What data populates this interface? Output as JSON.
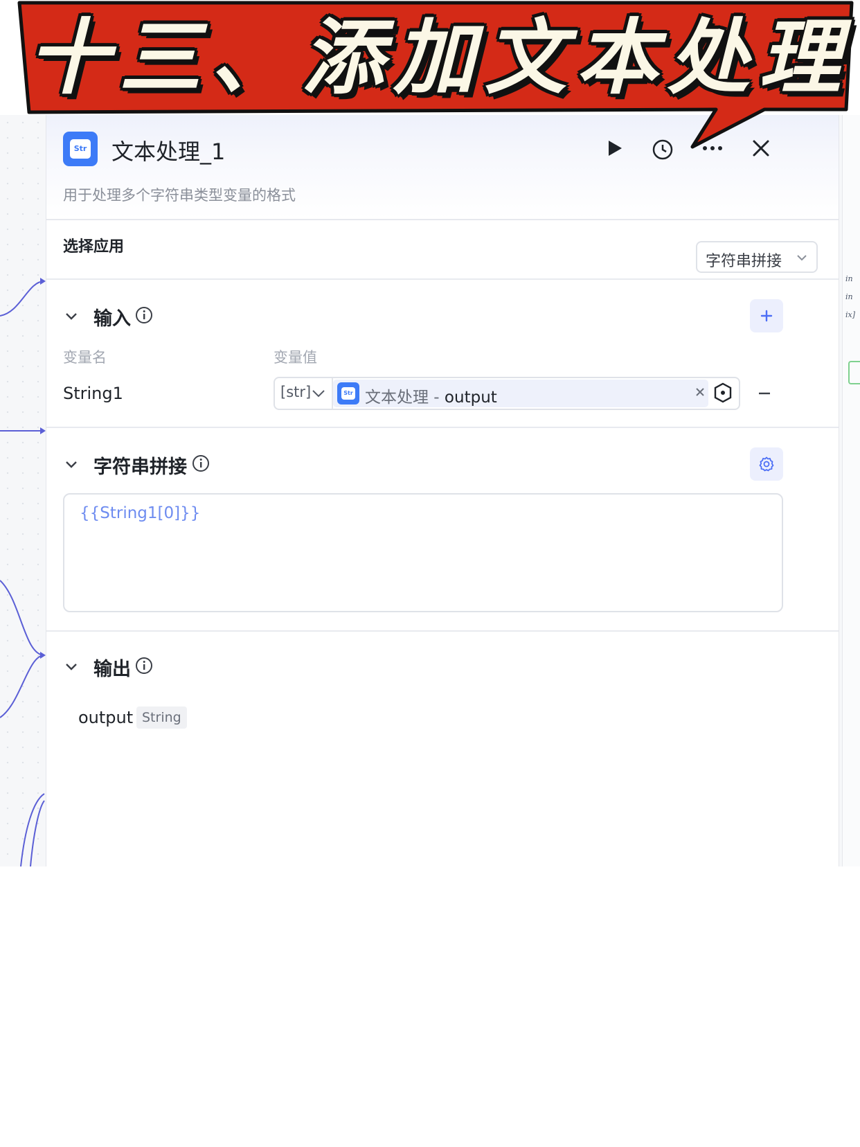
{
  "banner": {
    "title": "十三、添加文本处理",
    "color": "#d42a17"
  },
  "node": {
    "icon_text": "Str",
    "title": "文本处理_1",
    "description": "用于处理多个字符串类型变量的格式",
    "header_buttons": [
      "play-icon",
      "history-icon",
      "more-icon",
      "close-icon"
    ]
  },
  "app_select": {
    "label": "选择应用",
    "value": "字符串拼接"
  },
  "input": {
    "title": "输入",
    "col_name": "变量名",
    "col_value": "变量值",
    "rows": [
      {
        "name": "String1",
        "type": "[str]",
        "ref_icon_text": "Str",
        "ref_node": "文本处理",
        "ref_sep": " - ",
        "ref_var": "output"
      }
    ]
  },
  "concat": {
    "title": "字符串拼接",
    "template": "{{String1[0]}}"
  },
  "output": {
    "title": "输出",
    "var_name": "output",
    "var_type": "String"
  },
  "side_labels": [
    "in",
    "in",
    "ix]"
  ],
  "colors": {
    "accent": "#3d7bf7",
    "wire": "#5b5fd6",
    "template_text": "#6e8cf0"
  }
}
